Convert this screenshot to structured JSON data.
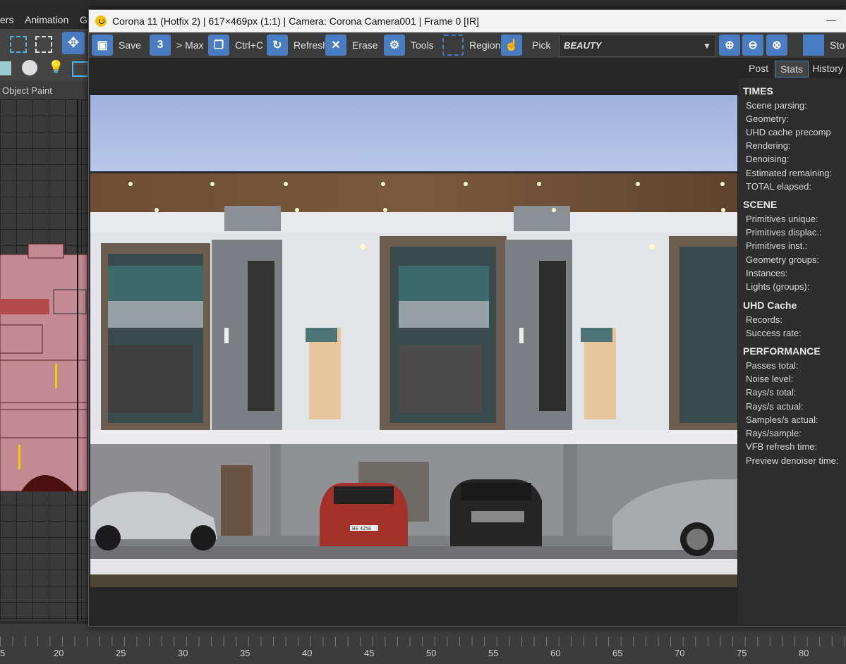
{
  "max": {
    "menu": [
      "ers",
      "Animation",
      "Gr"
    ],
    "object_paint_label": "Object Paint",
    "timeline_ticks": [
      "5",
      "20",
      "25",
      "30",
      "35",
      "40",
      "45",
      "50",
      "55",
      "60",
      "65",
      "70",
      "75",
      "80"
    ]
  },
  "vfb": {
    "title": "Corona 11 (Hotfix 2) | 617×469px (1:1) | Camera: Corona Camera001 | Frame 0 [IR]",
    "minimize": "—",
    "toolbar": [
      {
        "label": "Save",
        "icon": "save-icon"
      },
      {
        "label": "> Max",
        "icon": "number-3-icon"
      },
      {
        "label": "Ctrl+C",
        "icon": "copy-icon"
      },
      {
        "label": "Refresh",
        "icon": "refresh-icon"
      },
      {
        "label": "Erase",
        "icon": "erase-icon"
      },
      {
        "label": "Tools",
        "icon": "gear-icon"
      },
      {
        "label": "Region",
        "icon": "region-icon"
      },
      {
        "label": "Pick",
        "icon": "pointer-icon"
      }
    ],
    "channel": "BEAUTY",
    "stop_label": "Sto",
    "tabs": [
      {
        "label": "Post"
      },
      {
        "label": "Stats"
      },
      {
        "label": "History"
      }
    ],
    "stats": {
      "times_title": "TIMES",
      "times": [
        "Scene parsing:",
        "Geometry:",
        "UHD cache precomp",
        "Rendering:",
        "Denoising:",
        "Estimated remaining:",
        "TOTAL elapsed:"
      ],
      "scene_title": "SCENE",
      "scene": [
        "Primitives unique:",
        "Primitives displac.:",
        "Primitives inst.:",
        "Geometry groups:",
        "Instances:",
        "Lights (groups):"
      ],
      "uhd_title": "UHD Cache",
      "uhd": [
        "Records:",
        "Success rate:"
      ],
      "perf_title": "PERFORMANCE",
      "perf": [
        "Passes total:",
        "Noise level:",
        "Rays/s total:",
        "Rays/s actual:",
        "Samples/s actual:",
        "Rays/sample:",
        "VFB refresh time:",
        "Preview denoiser time:"
      ]
    }
  },
  "colors": {
    "accent": "#4a7cc2",
    "tab_border": "#4f7fb5"
  },
  "render": {
    "plate": "BE 4258"
  }
}
